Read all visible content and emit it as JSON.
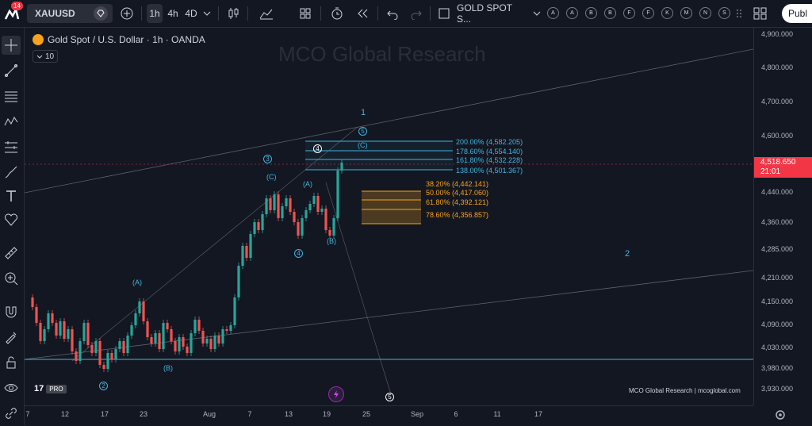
{
  "toolbar": {
    "notification_count": "14",
    "symbol": "XAUUSD",
    "timeframes": [
      "1h",
      "4h",
      "4D"
    ],
    "active_timeframe": "1h",
    "layout_name": "GOLD SPOT S...",
    "alert_buttons": [
      "A",
      "A",
      "B",
      "B",
      "F",
      "F",
      "K",
      "M",
      "N",
      "S"
    ],
    "publish_label": "Publ"
  },
  "legend": {
    "title": "Gold Spot / U.S. Dollar · 1h · OANDA",
    "indicator_count": "10"
  },
  "watermark": "MCO Global Research",
  "price_scale": {
    "labels": [
      "4,900.000",
      "4,800.000",
      "4,700.000",
      "4,600.000",
      "4,440.000",
      "4,360.000",
      "4,285.000",
      "4,210.000",
      "4,150.000",
      "4,090.000",
      "4,030.000",
      "3,980.000",
      "3,930.000"
    ],
    "current_price": "4,518.650",
    "countdown": "21:01"
  },
  "time_scale": {
    "labels": [
      "7",
      "12",
      "17",
      "23",
      "Aug",
      "7",
      "13",
      "19",
      "25",
      "Sep",
      "6",
      "11",
      "17"
    ]
  },
  "fib_extensions": [
    {
      "label": "200.00% (4,582.205)"
    },
    {
      "label": "178.60% (4,554.140)"
    },
    {
      "label": "161.80% (4,532.228)"
    },
    {
      "label": "138.00% (4,501.367)"
    }
  ],
  "fib_retracements": [
    {
      "label": "38.20% (4,442.141)"
    },
    {
      "label": "50.00% (4,417.060)"
    },
    {
      "label": "61.80% (4,392.121)"
    },
    {
      "label": "78.60% (4,356.857)"
    }
  ],
  "wave_labels": {
    "w1": "1",
    "w2": "2",
    "c3": "3",
    "c4": "4",
    "c4b": "4",
    "c5": "5",
    "c5b": "5",
    "c2": "2",
    "A1": "(A)",
    "A2": "(A)",
    "B1": "(B)",
    "B2": "(B)",
    "C1": "(C)",
    "C2": "(C)"
  },
  "footer_credit": "MCO Global Research | mcoglobal.com",
  "tv_logo": "PRO",
  "colors": {
    "background": "#131722",
    "wave_blue": "#42b4de",
    "fib_orange": "#f7a21b",
    "bull": "#26a69a",
    "bear": "#ef5350"
  }
}
